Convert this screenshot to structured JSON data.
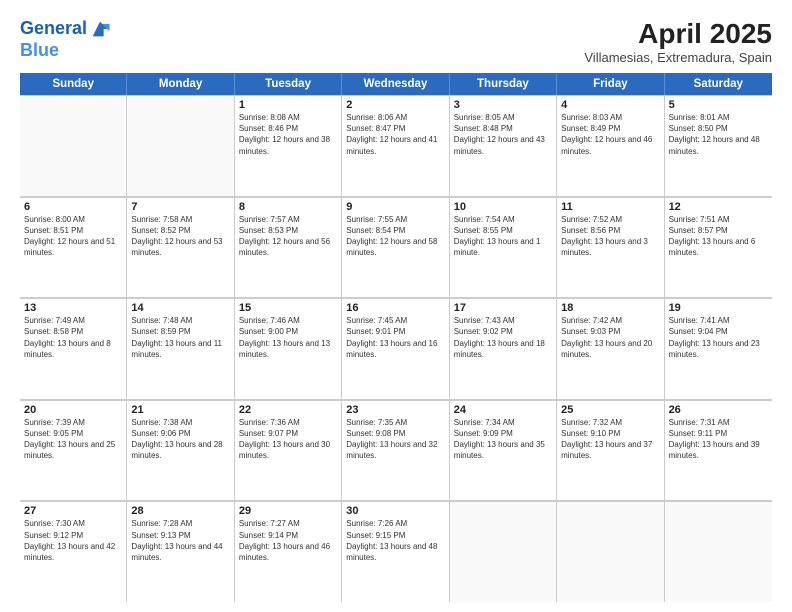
{
  "header": {
    "logo_line1": "General",
    "logo_line2": "Blue",
    "title": "April 2025",
    "subtitle": "Villamesias, Extremadura, Spain"
  },
  "days": [
    "Sunday",
    "Monday",
    "Tuesday",
    "Wednesday",
    "Thursday",
    "Friday",
    "Saturday"
  ],
  "rows": [
    [
      {
        "day": "",
        "empty": true
      },
      {
        "day": "",
        "empty": true
      },
      {
        "day": "1",
        "sunrise": "8:08 AM",
        "sunset": "8:46 PM",
        "daylight": "12 hours and 38 minutes."
      },
      {
        "day": "2",
        "sunrise": "8:06 AM",
        "sunset": "8:47 PM",
        "daylight": "12 hours and 41 minutes."
      },
      {
        "day": "3",
        "sunrise": "8:05 AM",
        "sunset": "8:48 PM",
        "daylight": "12 hours and 43 minutes."
      },
      {
        "day": "4",
        "sunrise": "8:03 AM",
        "sunset": "8:49 PM",
        "daylight": "12 hours and 46 minutes."
      },
      {
        "day": "5",
        "sunrise": "8:01 AM",
        "sunset": "8:50 PM",
        "daylight": "12 hours and 48 minutes."
      }
    ],
    [
      {
        "day": "6",
        "sunrise": "8:00 AM",
        "sunset": "8:51 PM",
        "daylight": "12 hours and 51 minutes."
      },
      {
        "day": "7",
        "sunrise": "7:58 AM",
        "sunset": "8:52 PM",
        "daylight": "12 hours and 53 minutes."
      },
      {
        "day": "8",
        "sunrise": "7:57 AM",
        "sunset": "8:53 PM",
        "daylight": "12 hours and 56 minutes."
      },
      {
        "day": "9",
        "sunrise": "7:55 AM",
        "sunset": "8:54 PM",
        "daylight": "12 hours and 58 minutes."
      },
      {
        "day": "10",
        "sunrise": "7:54 AM",
        "sunset": "8:55 PM",
        "daylight": "13 hours and 1 minute."
      },
      {
        "day": "11",
        "sunrise": "7:52 AM",
        "sunset": "8:56 PM",
        "daylight": "13 hours and 3 minutes."
      },
      {
        "day": "12",
        "sunrise": "7:51 AM",
        "sunset": "8:57 PM",
        "daylight": "13 hours and 6 minutes."
      }
    ],
    [
      {
        "day": "13",
        "sunrise": "7:49 AM",
        "sunset": "8:58 PM",
        "daylight": "13 hours and 8 minutes."
      },
      {
        "day": "14",
        "sunrise": "7:48 AM",
        "sunset": "8:59 PM",
        "daylight": "13 hours and 11 minutes."
      },
      {
        "day": "15",
        "sunrise": "7:46 AM",
        "sunset": "9:00 PM",
        "daylight": "13 hours and 13 minutes."
      },
      {
        "day": "16",
        "sunrise": "7:45 AM",
        "sunset": "9:01 PM",
        "daylight": "13 hours and 16 minutes."
      },
      {
        "day": "17",
        "sunrise": "7:43 AM",
        "sunset": "9:02 PM",
        "daylight": "13 hours and 18 minutes."
      },
      {
        "day": "18",
        "sunrise": "7:42 AM",
        "sunset": "9:03 PM",
        "daylight": "13 hours and 20 minutes."
      },
      {
        "day": "19",
        "sunrise": "7:41 AM",
        "sunset": "9:04 PM",
        "daylight": "13 hours and 23 minutes."
      }
    ],
    [
      {
        "day": "20",
        "sunrise": "7:39 AM",
        "sunset": "9:05 PM",
        "daylight": "13 hours and 25 minutes."
      },
      {
        "day": "21",
        "sunrise": "7:38 AM",
        "sunset": "9:06 PM",
        "daylight": "13 hours and 28 minutes."
      },
      {
        "day": "22",
        "sunrise": "7:36 AM",
        "sunset": "9:07 PM",
        "daylight": "13 hours and 30 minutes."
      },
      {
        "day": "23",
        "sunrise": "7:35 AM",
        "sunset": "9:08 PM",
        "daylight": "13 hours and 32 minutes."
      },
      {
        "day": "24",
        "sunrise": "7:34 AM",
        "sunset": "9:09 PM",
        "daylight": "13 hours and 35 minutes."
      },
      {
        "day": "25",
        "sunrise": "7:32 AM",
        "sunset": "9:10 PM",
        "daylight": "13 hours and 37 minutes."
      },
      {
        "day": "26",
        "sunrise": "7:31 AM",
        "sunset": "9:11 PM",
        "daylight": "13 hours and 39 minutes."
      }
    ],
    [
      {
        "day": "27",
        "sunrise": "7:30 AM",
        "sunset": "9:12 PM",
        "daylight": "13 hours and 42 minutes."
      },
      {
        "day": "28",
        "sunrise": "7:28 AM",
        "sunset": "9:13 PM",
        "daylight": "13 hours and 44 minutes."
      },
      {
        "day": "29",
        "sunrise": "7:27 AM",
        "sunset": "9:14 PM",
        "daylight": "13 hours and 46 minutes."
      },
      {
        "day": "30",
        "sunrise": "7:26 AM",
        "sunset": "9:15 PM",
        "daylight": "13 hours and 48 minutes."
      },
      {
        "day": "",
        "empty": true
      },
      {
        "day": "",
        "empty": true
      },
      {
        "day": "",
        "empty": true
      }
    ]
  ]
}
